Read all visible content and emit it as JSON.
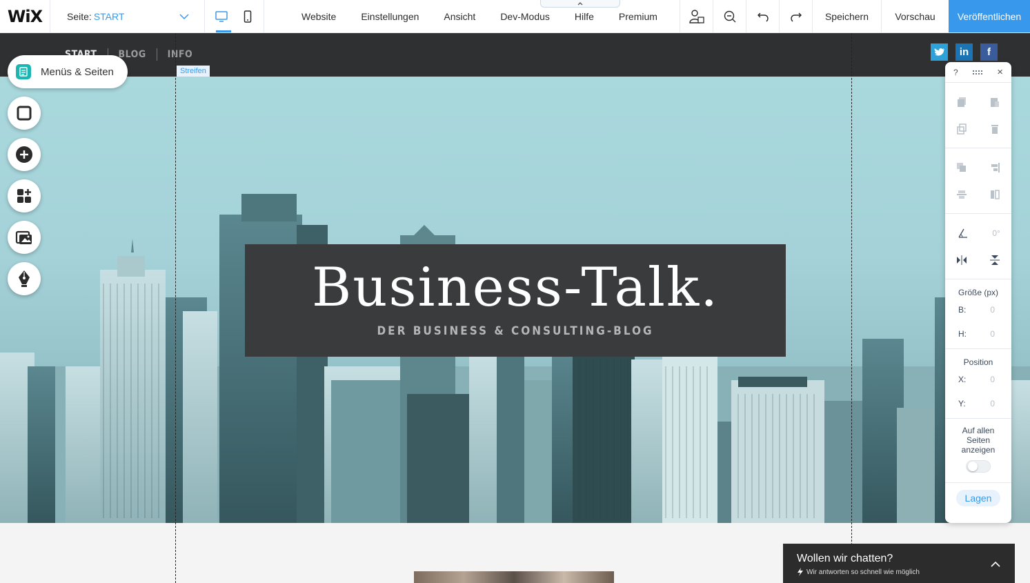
{
  "topbar": {
    "logo": "WiX",
    "page_prefix": "Seite:",
    "page_value": "START",
    "menu": [
      "Website",
      "Einstellungen",
      "Ansicht",
      "Dev-Modus",
      "Hilfe",
      "Premium"
    ],
    "save": "Speichern",
    "preview": "Vorschau",
    "publish": "Veröffentlichen"
  },
  "site": {
    "nav": [
      "START",
      "BLOG",
      "INFO"
    ],
    "strip_label": "Streifen",
    "title": "Business-Talk.",
    "subtitle": "DER BUSINESS & CONSULTING-BLOG"
  },
  "left_panel": {
    "menus_label": "Menüs & Seiten"
  },
  "inspector": {
    "help": "?",
    "close": "×",
    "rotation": "0°",
    "size_label": "Größe (px)",
    "width_label": "B:",
    "width_value": "0",
    "height_label": "H:",
    "height_value": "0",
    "position_label": "Position",
    "x_label": "X:",
    "x_value": "0",
    "y_label": "Y:",
    "y_value": "0",
    "show_all_label": "Auf allen Seiten anzeigen",
    "layers": "Lagen"
  },
  "chat": {
    "title": "Wollen wir chatten?",
    "subtitle": "Wir antworten so schnell wie möglich"
  },
  "colors": {
    "accent": "#3899ec",
    "header_bg": "#2f3032",
    "title_box": "#3a3b3d",
    "teal": "#1bb5b2"
  }
}
